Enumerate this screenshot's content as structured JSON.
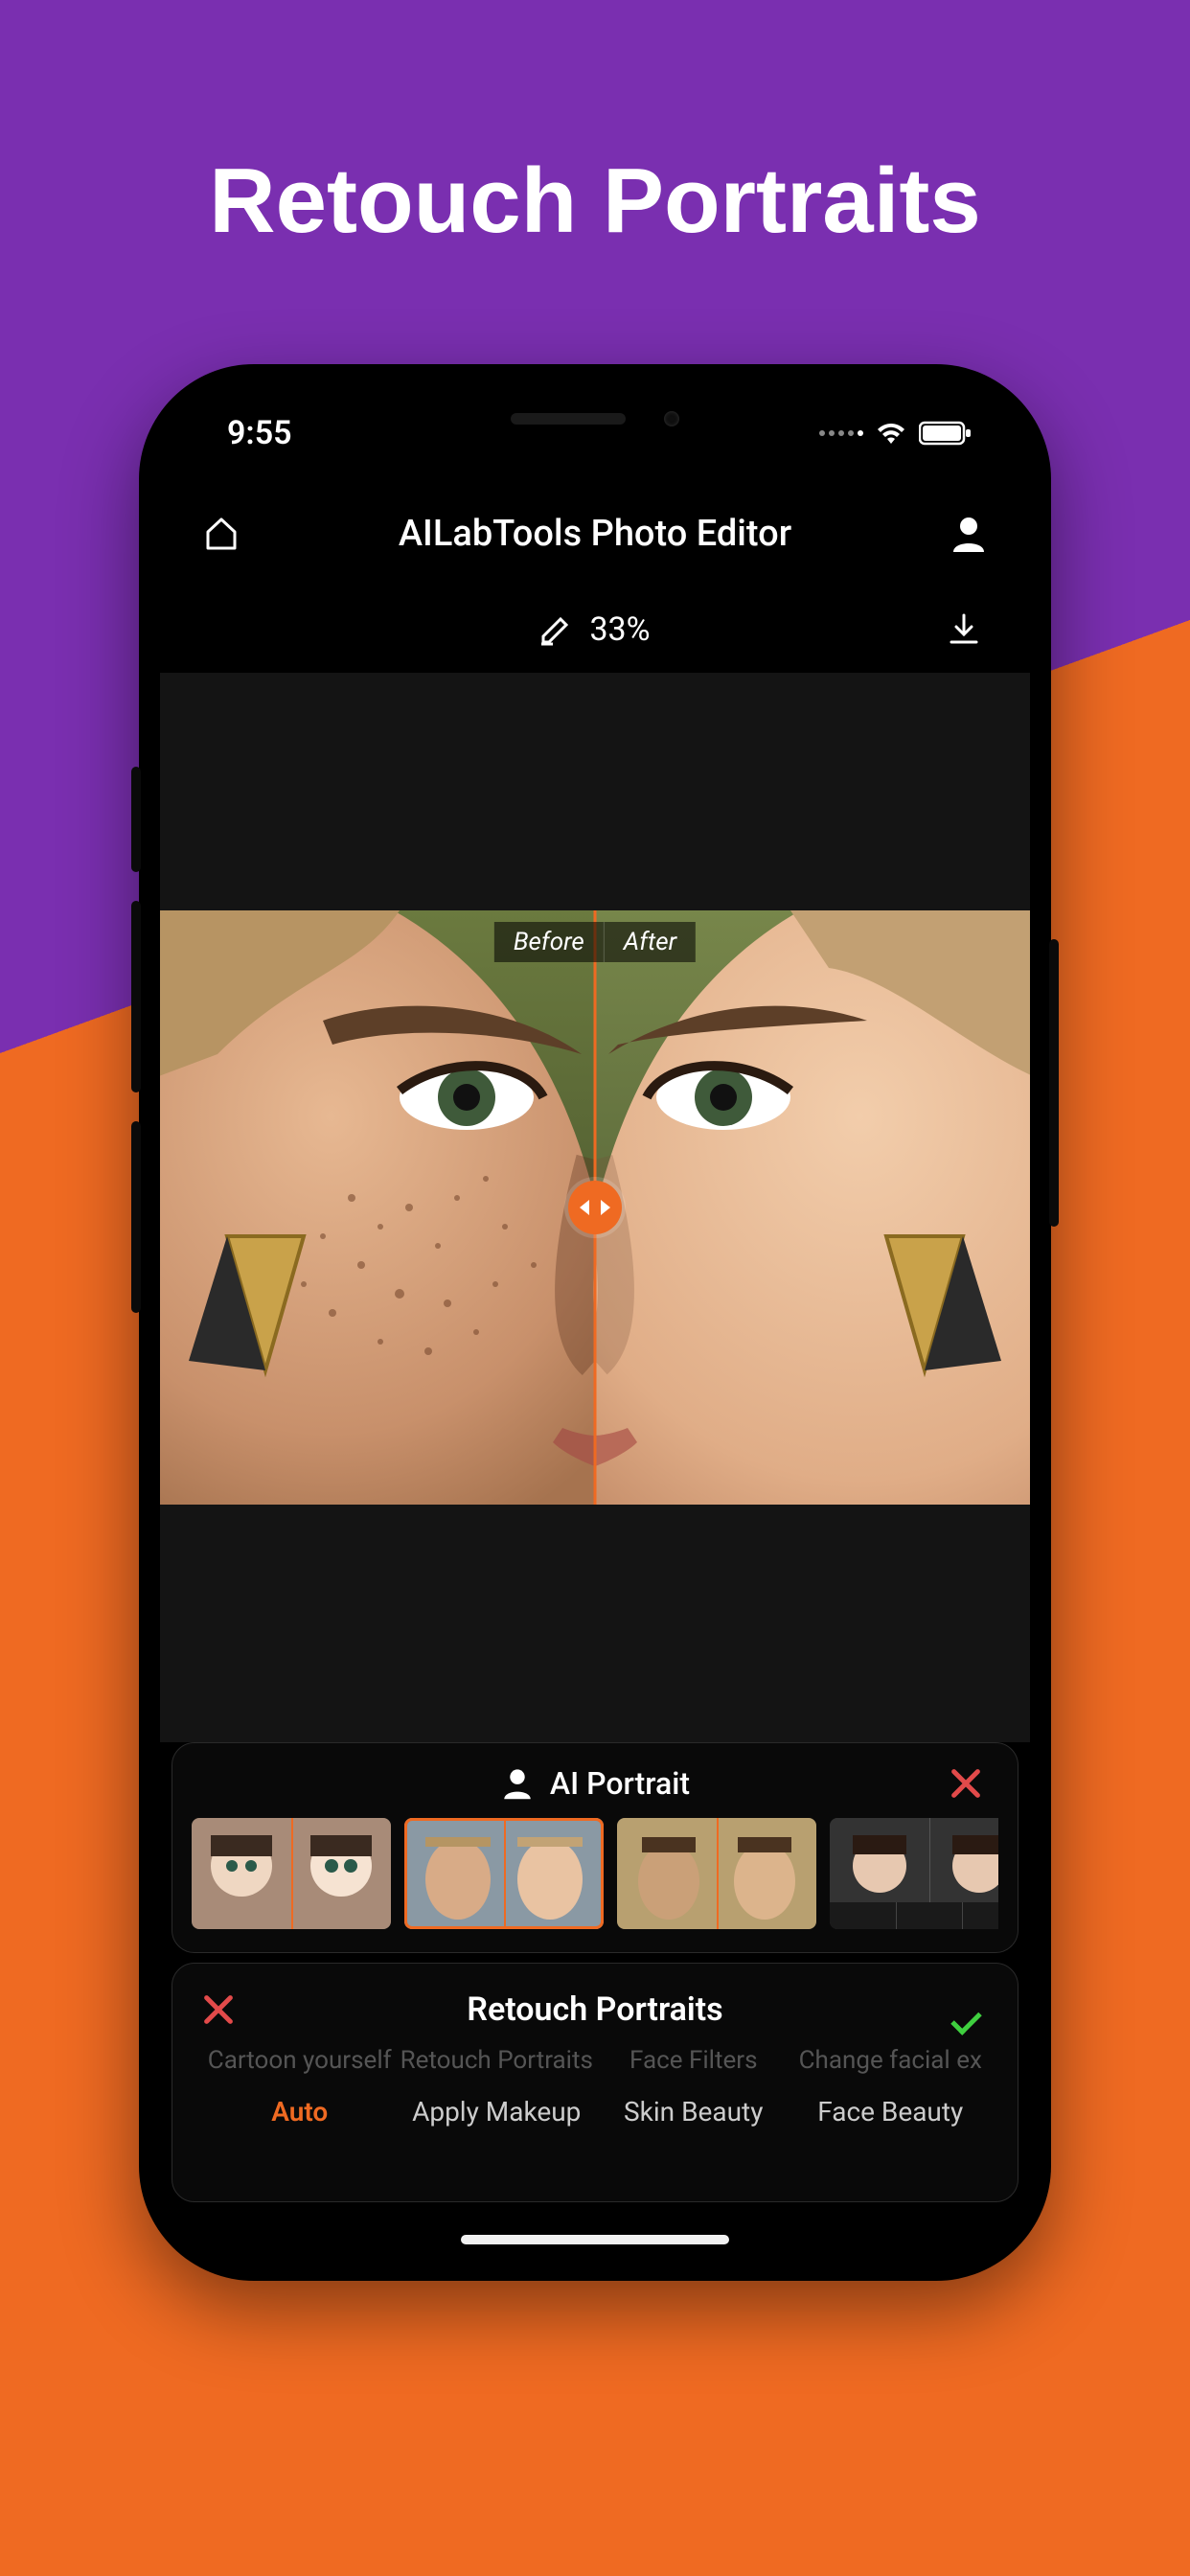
{
  "marketing_title": "Retouch Portraits",
  "status": {
    "time": "9:55"
  },
  "app": {
    "title": "AILabTools Photo Editor",
    "zoom_label": "33%"
  },
  "compare": {
    "before_label": "Before",
    "after_label": "After"
  },
  "panel_top": {
    "title": "AI Portrait"
  },
  "panel_bottom": {
    "title": "Retouch Portraits",
    "muted_items": [
      "Cartoon yourself",
      "Retouch Portraits",
      "Face Filters",
      "Change facial ex"
    ],
    "tabs": [
      "Auto",
      "Apply Makeup",
      "Skin Beauty",
      "Face Beauty"
    ],
    "active_tab_index": 0
  },
  "colors": {
    "accent": "#ef6a22",
    "purple": "#7a2fb0"
  }
}
